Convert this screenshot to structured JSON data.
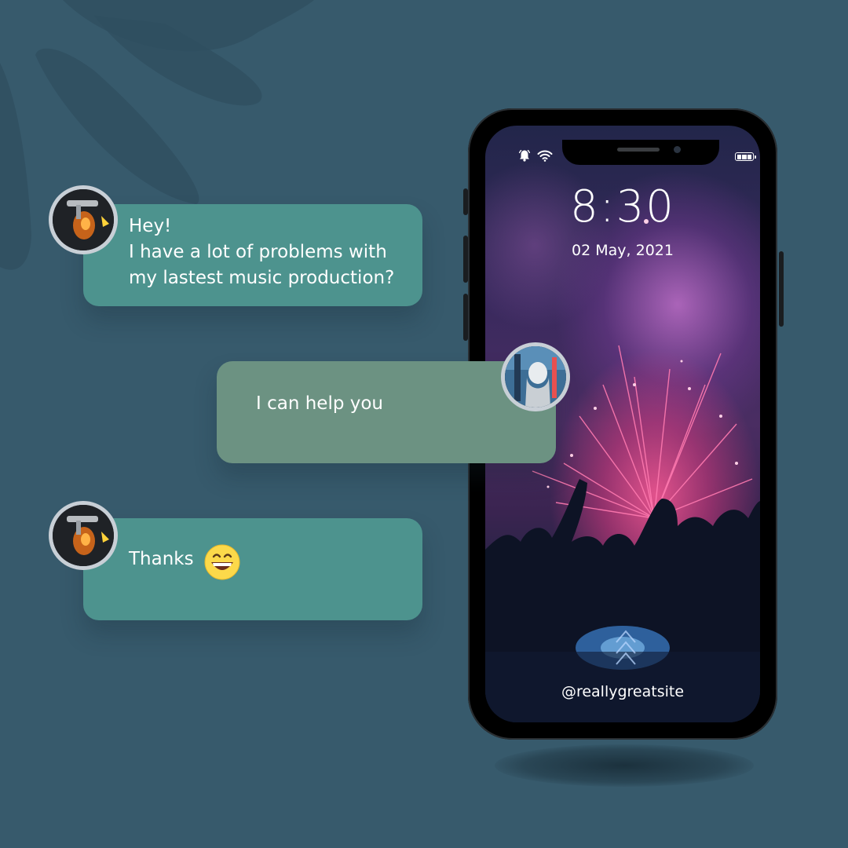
{
  "messages": [
    {
      "text": "Hey!\nI have a lot of problems with\nmy lastest music production?"
    },
    {
      "text": "I can help you"
    },
    {
      "text": "Thanks",
      "emoji": "grinning-face-emoji"
    }
  ],
  "phone": {
    "time": "8:30",
    "date": "02 May, 2021",
    "handle": "@reallygreatsite",
    "status_icons": [
      "alarm-bell-icon",
      "wifi-icon",
      "battery-icon"
    ]
  },
  "colors": {
    "background": "#375a6c",
    "bubble_teal": "#4d938e",
    "bubble_sage": "#6c9282",
    "avatar_ring": "#c8cfd6"
  }
}
